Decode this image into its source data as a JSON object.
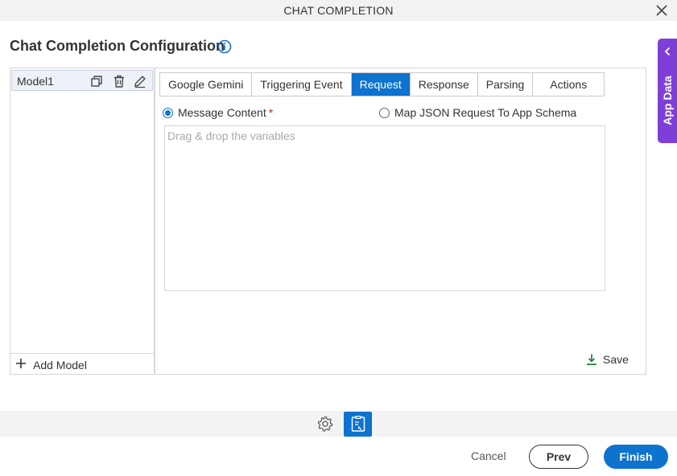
{
  "window": {
    "title": "CHAT COMPLETION"
  },
  "page": {
    "heading": "Chat Completion Configuration"
  },
  "models": {
    "items": [
      {
        "label": "Model1"
      }
    ],
    "add_label": "Add Model"
  },
  "tabs": [
    {
      "label": "Google Gemini",
      "active": false
    },
    {
      "label": "Triggering Event",
      "active": false
    },
    {
      "label": "Request",
      "active": true
    },
    {
      "label": "Response",
      "active": false
    },
    {
      "label": "Parsing",
      "active": false
    },
    {
      "label": "Actions",
      "active": false
    }
  ],
  "request": {
    "option_message_content": "Message Content",
    "required_marker": "*",
    "option_map_json": "Map JSON Request To App Schema",
    "selected_option": "message_content",
    "dropzone_value": "",
    "dropzone_placeholder": "Drag & drop the variables",
    "save_label": "Save"
  },
  "side_tab": {
    "label": "App Data"
  },
  "footer": {
    "cancel_label": "Cancel",
    "prev_label": "Prev",
    "finish_label": "Finish"
  },
  "colors": {
    "accent": "#0e72cf",
    "side_tab": "#7e3fd8",
    "required": "#d9261c",
    "save_icon": "#1e7b34"
  },
  "icons": {
    "close": "close-icon",
    "info": "info-icon",
    "copy": "copy-icon",
    "delete": "trash-icon",
    "edit": "pencil-icon",
    "add": "plus-icon",
    "save": "download-icon",
    "expand": "chevron-left-icon",
    "settings": "gear-icon",
    "document": "document-icon"
  }
}
